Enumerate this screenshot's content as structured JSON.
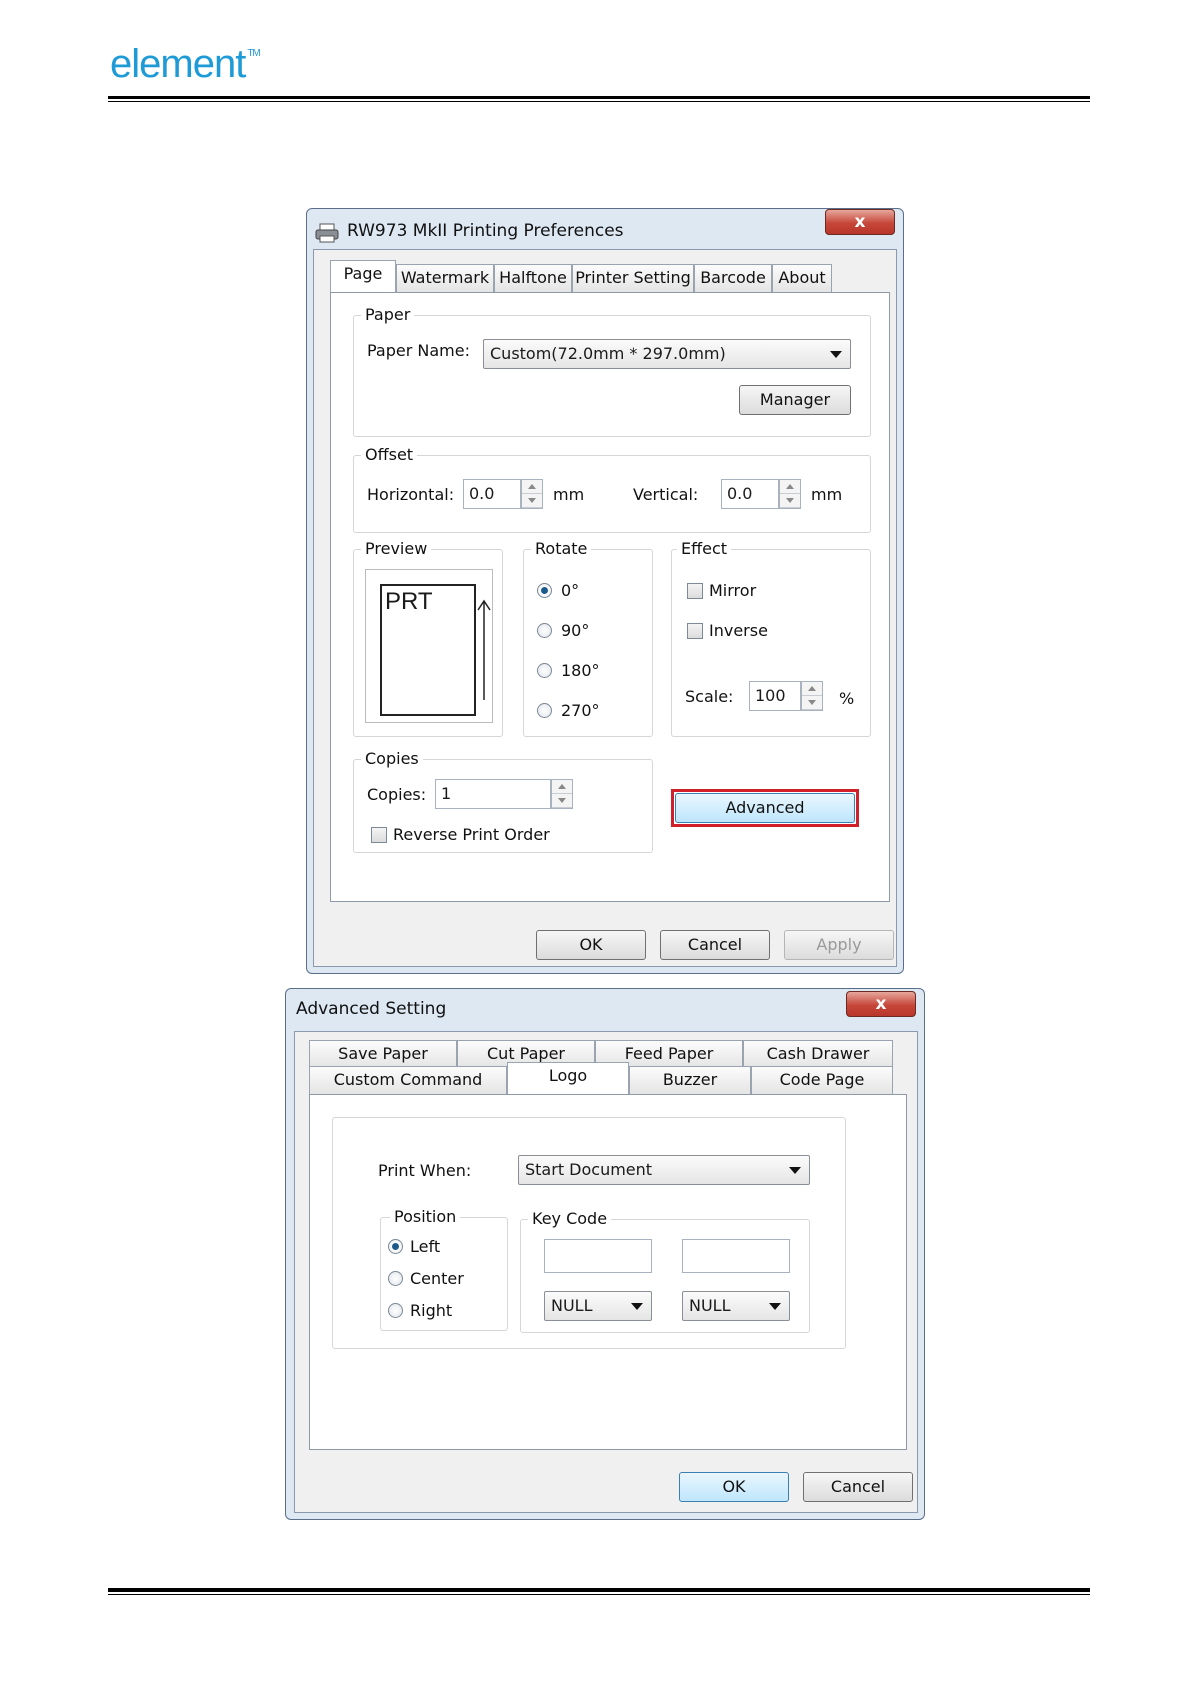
{
  "brand": {
    "logo_text": "element",
    "trademark": "TM"
  },
  "prefs_dialog": {
    "title": "RW973 MkII Printing Preferences",
    "close_glyph": "x",
    "tabs": [
      "Page",
      "Watermark",
      "Halftone",
      "Printer Setting",
      "Barcode",
      "About"
    ],
    "active_tab": "Page",
    "paper": {
      "group_label": "Paper",
      "name_label": "Paper Name:",
      "name_value": "Custom(72.0mm * 297.0mm)",
      "manager_button": "Manager"
    },
    "offset": {
      "group_label": "Offset",
      "horizontal_label": "Horizontal:",
      "horizontal_value": "0.0",
      "horizontal_unit": "mm",
      "vertical_label": "Vertical:",
      "vertical_value": "0.0",
      "vertical_unit": "mm"
    },
    "preview": {
      "group_label": "Preview",
      "text": "PRT"
    },
    "rotate": {
      "group_label": "Rotate",
      "options": [
        "0°",
        "90°",
        "180°",
        "270°"
      ],
      "selected": "0°"
    },
    "effect": {
      "group_label": "Effect",
      "mirror_label": "Mirror",
      "inverse_label": "Inverse",
      "scale_label": "Scale:",
      "scale_value": "100",
      "scale_unit": "%"
    },
    "copies": {
      "group_label": "Copies",
      "copies_label": "Copies:",
      "copies_value": "1",
      "reverse_label": "Reverse Print Order"
    },
    "advanced_button": "Advanced",
    "highlight_color": "#d0202a",
    "buttons": {
      "ok": "OK",
      "cancel": "Cancel",
      "apply": "Apply"
    }
  },
  "advanced_dialog": {
    "title": "Advanced Setting",
    "close_glyph": "x",
    "tabs_row1": [
      "Save Paper",
      "Cut Paper",
      "Feed Paper",
      "Cash Drawer"
    ],
    "tabs_row2": [
      "Custom Command",
      "Logo",
      "Buzzer",
      "Code Page"
    ],
    "active_tab": "Logo",
    "print_when_label": "Print When:",
    "print_when_value": "Start Document",
    "position": {
      "group_label": "Position",
      "options": [
        "Left",
        "Center",
        "Right"
      ],
      "selected": "Left"
    },
    "key_code": {
      "group_label": "Key Code",
      "field1": "",
      "field2": "",
      "select1": "NULL",
      "select2": "NULL"
    },
    "buttons": {
      "ok": "OK",
      "cancel": "Cancel"
    }
  }
}
